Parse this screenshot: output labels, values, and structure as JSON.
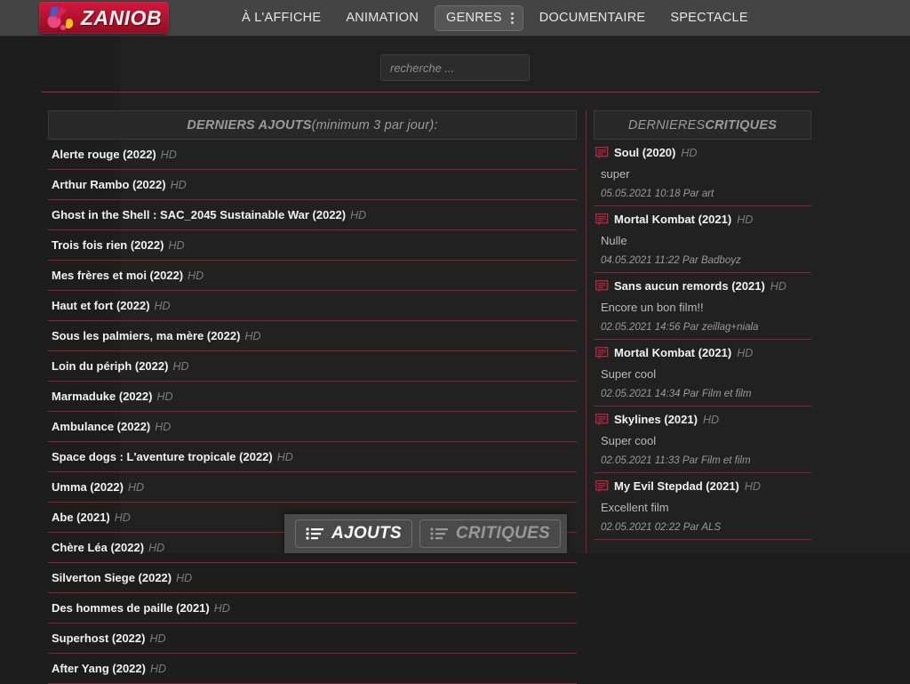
{
  "site": {
    "logo_text": "ZANIOB",
    "logo_icon": "colorful-shapes-icon"
  },
  "nav": {
    "items": [
      {
        "label": "À L'AFFICHE",
        "boxed": false
      },
      {
        "label": "ANIMATION",
        "boxed": false
      },
      {
        "label": "GENRES",
        "boxed": true,
        "icon": "kebab-menu-icon"
      },
      {
        "label": "DOCUMENTAIRE",
        "boxed": false
      },
      {
        "label": "SPECTACLE",
        "boxed": false
      }
    ]
  },
  "search": {
    "placeholder": "recherche ...",
    "value": ""
  },
  "ajouts": {
    "header_main": "DERNIERS AJOUTS",
    "header_sub": " (minimum 3 par jour):",
    "items": [
      {
        "title": "Alerte rouge (2022)",
        "quality": "HD"
      },
      {
        "title": "Arthur Rambo (2022)",
        "quality": "HD"
      },
      {
        "title": "Ghost in the Shell : SAC_2045 Sustainable War (2022)",
        "quality": "HD"
      },
      {
        "title": "Trois fois rien (2022)",
        "quality": "HD"
      },
      {
        "title": "Mes frères et moi (2022)",
        "quality": "HD"
      },
      {
        "title": "Haut et fort (2022)",
        "quality": "HD"
      },
      {
        "title": "Sous les palmiers, ma mère (2022)",
        "quality": "HD"
      },
      {
        "title": "Loin du périph (2022)",
        "quality": "HD"
      },
      {
        "title": "Marmaduke (2022)",
        "quality": "HD"
      },
      {
        "title": "Ambulance (2022)",
        "quality": "HD"
      },
      {
        "title": "Space dogs : L'aventure tropicale (2022)",
        "quality": "HD"
      },
      {
        "title": "Umma (2022)",
        "quality": "HD"
      },
      {
        "title": "Abe (2021)",
        "quality": "HD"
      },
      {
        "title": "Chère Léa (2022)",
        "quality": "HD"
      },
      {
        "title": "Silverton Siege (2022)",
        "quality": "HD"
      },
      {
        "title": "Des hommes de paille (2021)",
        "quality": "HD"
      },
      {
        "title": "Superhost (2022)",
        "quality": "HD"
      },
      {
        "title": "After Yang (2022)",
        "quality": "HD"
      }
    ]
  },
  "critiques": {
    "header_main": "DERNIERES ",
    "header_em": "CRITIQUES",
    "items": [
      {
        "title": "Soul (2020)",
        "quality": "HD",
        "body": "super",
        "meta": "05.05.2021 10:18 Par art",
        "icon": "comment-icon"
      },
      {
        "title": "Mortal Kombat (2021)",
        "quality": "HD",
        "body": "Nulle",
        "meta": "04.05.2021 11:22 Par Badboyz",
        "icon": "comment-icon"
      },
      {
        "title": "Sans aucun remords (2021)",
        "quality": "HD",
        "body": "Encore un bon film!!",
        "meta": "02.05.2021 14:56 Par zeillag+niala",
        "icon": "comment-icon"
      },
      {
        "title": "Mortal Kombat (2021)",
        "quality": "HD",
        "body": "Super cool",
        "meta": "02.05.2021 14:34 Par Film et film",
        "icon": "comment-icon"
      },
      {
        "title": "Skylines (2021)",
        "quality": "HD",
        "body": "Super cool",
        "meta": "02.05.2021 11:33 Par Film et film",
        "icon": "comment-icon"
      },
      {
        "title": "My Evil Stepdad (2021)",
        "quality": "HD",
        "body": "Excellent film",
        "meta": "02.05.2021 02:22 Par ALS",
        "icon": "comment-icon"
      }
    ]
  },
  "tabbar": {
    "tabs": [
      {
        "label": "AJOUTS",
        "icon": "list-icon",
        "active": true
      },
      {
        "label": "CRITIQUES",
        "icon": "list-icon",
        "active": false
      }
    ]
  },
  "colors": {
    "accent_red": "#8e2038",
    "brand_red": "#b3122f",
    "topbar": "#444444",
    "page_bg": "#1d1d1d",
    "content_bg": "#212121"
  }
}
